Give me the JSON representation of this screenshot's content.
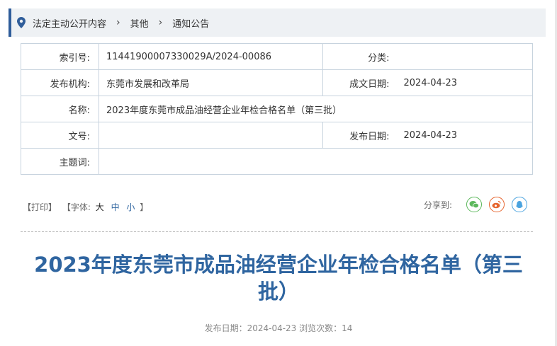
{
  "breadcrumb": {
    "items": [
      "法定主动公开内容",
      "其他",
      "通知公告"
    ],
    "separator": "›"
  },
  "meta": {
    "index_label": "索引号:",
    "index_value": "11441900007330029A/2024-00086",
    "category_label": "分类:",
    "category_value": "",
    "publisher_label": "发布机构:",
    "publisher_value": "东莞市发展和改革局",
    "created_label": "成文日期:",
    "created_value": "2024-04-23",
    "name_label": "名称:",
    "name_value": "2023年度东莞市成品油经营企业年检合格名单（第三批）",
    "doc_no_label": "文号:",
    "doc_no_value": "",
    "pub_date_label": "发布日期:",
    "pub_date_value": "2024-04-23",
    "subject_label": "主题词:",
    "subject_value": ""
  },
  "tools": {
    "print": "【打印】",
    "font_prefix": "【字体:",
    "font_large": "大",
    "font_medium": "中",
    "font_small": "小",
    "font_suffix": "】"
  },
  "share": {
    "label": "分享到:",
    "icons": [
      "wechat-icon",
      "weibo-icon",
      "qq-icon"
    ],
    "colors": {
      "wechat": "#5cb85c",
      "weibo": "#e6642d",
      "qq": "#4aa3df"
    }
  },
  "article": {
    "title": "2023年度东莞市成品油经营企业年检合格名单（第三批）",
    "info": "发布日期：2024-04-23  浏览次数：14"
  },
  "colors": {
    "accent": "#2f5d9a",
    "title": "#2f65a0",
    "border": "#c7d3de"
  }
}
